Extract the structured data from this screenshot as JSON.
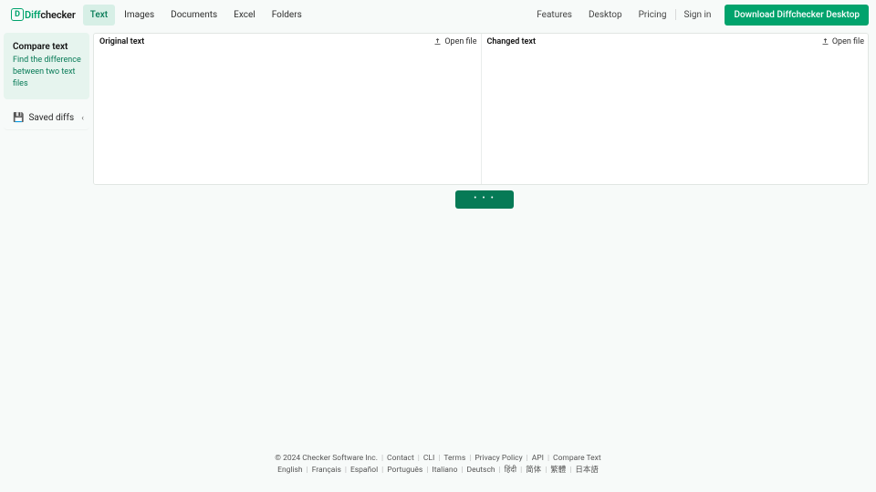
{
  "brand": {
    "badge_letter": "D",
    "name_prefix": "Diff",
    "name_suffix": "checker"
  },
  "nav": {
    "tabs": [
      {
        "label": "Text",
        "active": true
      },
      {
        "label": "Images"
      },
      {
        "label": "Documents"
      },
      {
        "label": "Excel"
      },
      {
        "label": "Folders"
      }
    ],
    "links": {
      "features": "Features",
      "desktop": "Desktop",
      "pricing": "Pricing",
      "signin": "Sign in"
    },
    "cta": "Download Diffchecker Desktop"
  },
  "sidebar": {
    "card": {
      "title": "Compare text",
      "desc": "Find the difference between two text files"
    },
    "saved": {
      "icon": "💾",
      "label": "Saved diffs"
    }
  },
  "panes": {
    "original": {
      "title": "Original text",
      "open": "Open file",
      "value": ""
    },
    "changed": {
      "title": "Changed text",
      "open": "Open file",
      "value": ""
    }
  },
  "compare_button": {
    "dots": "• • •"
  },
  "footer": {
    "copyright": "© 2024 Checker Software Inc.",
    "links": [
      "Contact",
      "CLI",
      "Terms",
      "Privacy Policy",
      "API",
      "Compare Text"
    ],
    "langs": [
      "English",
      "Français",
      "Español",
      "Português",
      "Italiano",
      "Deutsch",
      "हिंदी",
      "简体",
      "繁體",
      "日本語"
    ]
  }
}
